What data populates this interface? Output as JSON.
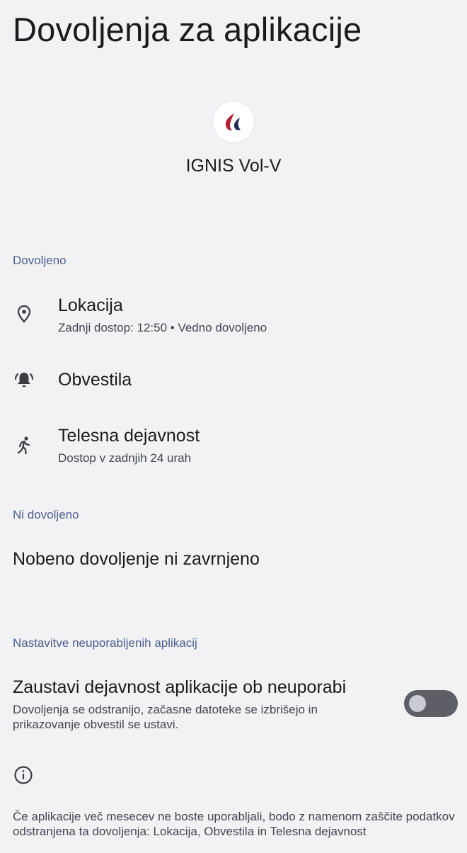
{
  "page": {
    "title": "Dovoljenja za aplikacije"
  },
  "app": {
    "name": "IGNIS Vol-V",
    "icon": "ignis-flame-logo-icon",
    "icon_color": "#b32036"
  },
  "allowed": {
    "header": "Dovoljeno",
    "items": [
      {
        "title": "Lokacija",
        "subtitle": "Zadnji dostop: 12:50 • Vedno dovoljeno",
        "icon": "location-pin-icon"
      },
      {
        "title": "Obvestila",
        "subtitle": "",
        "icon": "notification-bell-icon"
      },
      {
        "title": "Telesna dejavnost",
        "subtitle": "Dostop v zadnjih 24 urah",
        "icon": "physical-activity-icon"
      }
    ]
  },
  "not_allowed": {
    "header": "Ni dovoljeno",
    "empty_text": "Nobeno dovoljenje ni zavrnjeno"
  },
  "unused_apps": {
    "header": "Nastavitve neuporabljenih aplikacij",
    "title": "Zaustavi dejavnost aplikacije ob neuporabi",
    "subtitle": "Dovoljenja se odstranijo, začasne datoteke se izbrišejo in prikazovanje obvestil se ustavi.",
    "toggle_state": "off"
  },
  "footer": {
    "icon": "info-icon",
    "text": "Če aplikacije več mesecev ne boste uporabljali, bodo z namenom zaščite podatkov odstranjena ta dovoljenja: Lokacija, Obvestila in Telesna dejavnost"
  },
  "colors": {
    "background": "#f2f2f4",
    "section_header": "#4b5e8e",
    "toggle_track_off": "#5d5e66"
  }
}
